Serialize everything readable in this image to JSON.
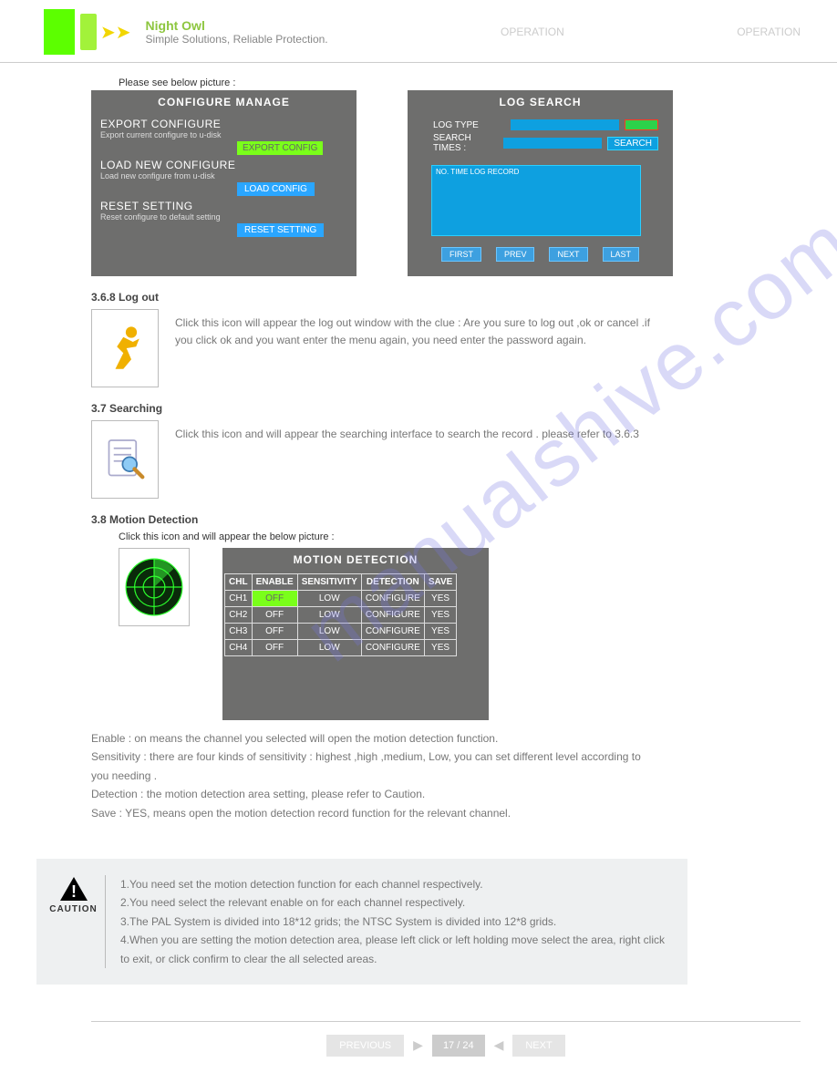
{
  "header": {
    "brand": "Night Owl",
    "sub": "Simple Solutions, Reliable Protection.",
    "mid": "OPERATION",
    "right": "OPERATION"
  },
  "watermark": "manualshive.com",
  "belowPic": "Please see below picture :",
  "configure": {
    "title": "CONFIGURE  MANAGE",
    "export_label": "EXPORT CONFIGURE",
    "export_sub": "Export current configure to u-disk",
    "export_btn": "EXPORT CONFIG",
    "load_label": "LOAD NEW CONFIGURE",
    "load_sub": "Load new configure from u-disk",
    "load_btn": "LOAD  CONFIG",
    "reset_label": "RESET SETTING",
    "reset_sub": "Reset configure to default setting",
    "reset_btn": "RESET SETTING"
  },
  "log": {
    "title": "LOG  SEARCH",
    "type_label": "LOG TYPE",
    "times_label": "SEARCH TIMES :",
    "search_btn": "SEARCH",
    "result_header": "NO.          TIME          LOG             RECORD",
    "pager": {
      "first": "FIRST",
      "prev": "PREV",
      "next": "NEXT",
      "last": "LAST"
    }
  },
  "logout": {
    "head": "3.6.8 Log out",
    "desc": "Click this icon will appear the log out window with the clue : Are you sure to log out ,ok or cancel .if you click ok and you want enter the menu again, you need enter the password again."
  },
  "search": {
    "head": "3.7 Searching",
    "desc": "Click this icon and will appear the searching interface to search the record . please refer to 3.6.3"
  },
  "md": {
    "head": "3.8 Motion Detection",
    "below": "Click this icon and  will appear the below picture :",
    "title": "MOTION DETECTION",
    "cols": {
      "ch": "CHL",
      "enable": "ENABLE",
      "sens": "SENSITIVITY",
      "det": "DETECTION",
      "save": "SAVE"
    },
    "rows": [
      {
        "ch": "CH1",
        "enable": "OFF",
        "enable_hi": true,
        "sens": "LOW",
        "det": "CONFIGURE",
        "save": "YES"
      },
      {
        "ch": "CH2",
        "enable": "OFF",
        "enable_hi": false,
        "sens": "LOW",
        "det": "CONFIGURE",
        "save": "YES"
      },
      {
        "ch": "CH3",
        "enable": "OFF",
        "enable_hi": false,
        "sens": "LOW",
        "det": "CONFIGURE",
        "save": "YES"
      },
      {
        "ch": "CH4",
        "enable": "OFF",
        "enable_hi": false,
        "sens": "LOW",
        "det": "CONFIGURE",
        "save": "YES"
      }
    ],
    "desc_lines": [
      "Enable : on means the channel you selected will open the motion detection function.",
      "Sensitivity : there are four kinds of sensitivity : highest ,high ,medium, Low, you can set different level according to you needing .",
      "Detection : the motion detection area setting, please refer to Caution.",
      "Save : YES, means open the motion detection record function for the relevant channel."
    ]
  },
  "caution": {
    "label": "CAUTION",
    "lines": [
      "1.You need set the motion detection function for each channel respectively.",
      "2.You need select the relevant enable on for each channel respectively.",
      "3.The PAL System is divided into 18*12 grids; the NTSC System is divided into 12*8 grids.",
      "4.When you are setting the motion detection area, please left click or left holding move select the area, right click to exit, or click confirm to clear the all selected areas."
    ]
  },
  "footer": {
    "prev": "PREVIOUS",
    "page": "17 / 24",
    "next": "NEXT"
  }
}
